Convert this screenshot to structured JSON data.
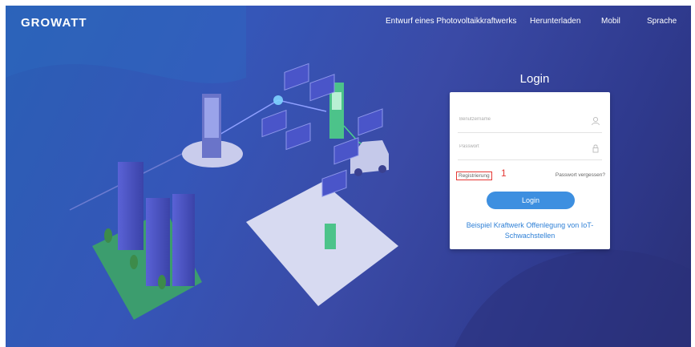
{
  "header": {
    "logo": "GROWATT",
    "nav": [
      "Entwurf eines Photovoltaikkraftwerks",
      "Herunterladen",
      "Mobil",
      "Sprache"
    ]
  },
  "login": {
    "title": "Login",
    "username_placeholder": "Benutzername",
    "password_placeholder": "Passwort",
    "register_label": "Registrierung",
    "annotation_number": "1",
    "forgot_label": "Passwort vergessen?",
    "login_button": "Login",
    "link_example": "Beispiel Kraftwerk",
    "link_iot": "Offenlegung von IoT-Schwachstellen"
  },
  "colors": {
    "accent": "#3d8fe0",
    "annotation": "#e53935"
  }
}
